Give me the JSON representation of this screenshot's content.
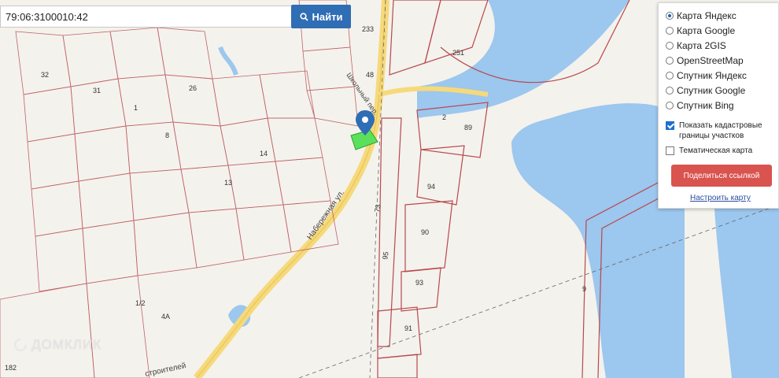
{
  "search": {
    "value": "79:06:3100010:42",
    "button_label": "Найти"
  },
  "layers": [
    {
      "label": "Карта Яндекс",
      "selected": true
    },
    {
      "label": "Карта Google",
      "selected": false
    },
    {
      "label": "Карта 2GIS",
      "selected": false
    },
    {
      "label": "OpenStreetMap",
      "selected": false
    },
    {
      "label": "Спутник Яндекс",
      "selected": false
    },
    {
      "label": "Спутник Google",
      "selected": false
    },
    {
      "label": "Спутник Bing",
      "selected": false
    }
  ],
  "options": {
    "cadastral_line1": "Показать кадастровые",
    "cadastral_line2": "границы участков",
    "cadastral_checked": true,
    "thematic": "Тематическая карта",
    "thematic_checked": false
  },
  "share_label": "Поделиться ссылкой",
  "setup_label": "Настроить карту",
  "map_labels": {
    "street_naberezhnaya": "Набережная ул.",
    "street_shkolny": "Школьный пер.",
    "street_stroiteley": "строителей",
    "parcels": [
      "251",
      "89",
      "2",
      "94",
      "90",
      "93",
      "91",
      "95",
      "73",
      "9",
      "1/2",
      "4А",
      "182",
      "233",
      "48",
      "13",
      "14",
      "32",
      "31",
      "1",
      "8",
      "26"
    ]
  },
  "watermark": "ДОМКЛИК",
  "colors": {
    "water": "#9cc7ee",
    "land": "#f4f2ec",
    "road": "#f6d97a",
    "parcel_line": "#b8484f",
    "selected_parcel": "#5be05b",
    "marker": "#2f6db5"
  }
}
